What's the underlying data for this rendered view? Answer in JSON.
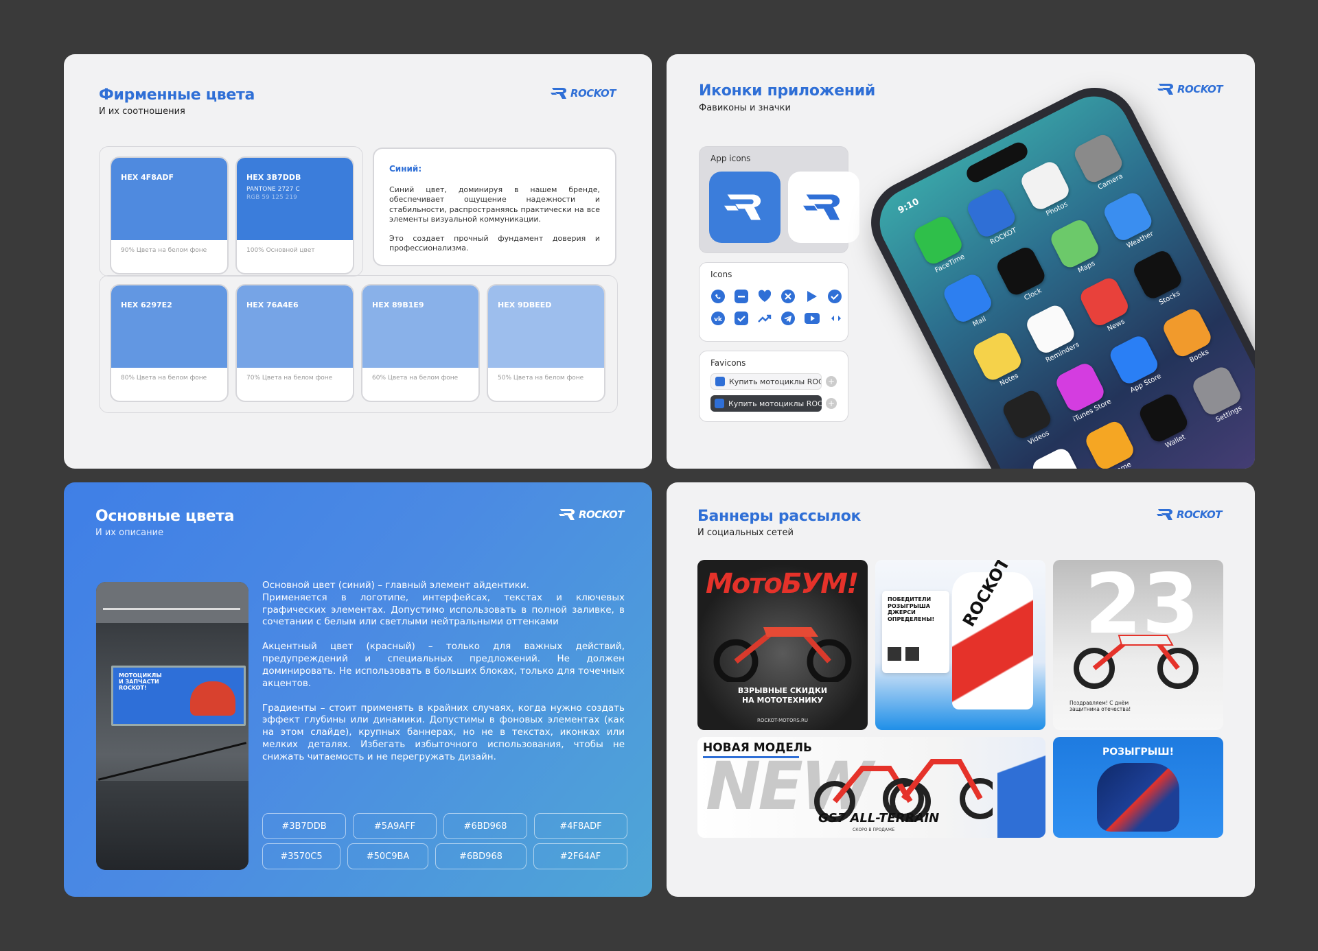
{
  "slide1": {
    "title": "Фирменные цвета",
    "subtitle": "И их соотношения",
    "logo_text": "ROCKOT",
    "cards": [
      {
        "hex": "HEX 4F8ADF",
        "color": "#4F8ADF",
        "extra1": "",
        "extra2": "",
        "caption": "90% Цвета на белом фоне"
      },
      {
        "hex": "HEX 3B7DDB",
        "color": "#3B7DDB",
        "extra1": "PANTONE 2727 C",
        "extra2": "RGB 59 125 219",
        "caption": "100% Основной цвет"
      },
      {
        "hex": "HEX 6297E2",
        "color": "#6297E2",
        "extra1": "",
        "extra2": "",
        "caption": "80% Цвета на белом фоне"
      },
      {
        "hex": "HEX 76A4E6",
        "color": "#76A4E6",
        "extra1": "",
        "extra2": "",
        "caption": "70% Цвета на белом фоне"
      },
      {
        "hex": "HEX 89B1E9",
        "color": "#89B1E9",
        "extra1": "",
        "extra2": "",
        "caption": "60% Цвета на белом фоне"
      },
      {
        "hex": "HEX 9DBEED",
        "color": "#9DBEED",
        "extra1": "",
        "extra2": "",
        "caption": "50% Цвета на белом фоне"
      }
    ],
    "desc_title": "Синий:",
    "desc_p1": "Синий цвет, доминируя в нашем бренде, обеспечивает ощущение надежности и стабильности, распространяясь практически на все элементы визуальной коммуникации.",
    "desc_p2": "Это создает прочный фундамент доверия и профессионализма."
  },
  "slide2": {
    "title": "Иконки приложений",
    "subtitle": "Фавиконы и значки",
    "logo_text": "ROCKOT",
    "app_icons_label": "App icons",
    "icons_label": "Icons",
    "icons": [
      "whatsapp-icon",
      "minus-icon",
      "heart-icon",
      "close-circle-icon",
      "play-icon",
      "check-circle-icon",
      "vk-icon",
      "checkbox-icon",
      "trend-up-icon",
      "telegram-icon",
      "youtube-icon",
      "arrows-icon"
    ],
    "favicons_label": "Favicons",
    "favicon_tab_text": "Купить мотоциклы ROCKOT",
    "phone": {
      "time": "9:10",
      "apps": [
        "FaceTime",
        "ROCKOT",
        "Photos",
        "Camera",
        "Mail",
        "Clock",
        "Maps",
        "Weather",
        "Notes",
        "Reminders",
        "News",
        "Stocks",
        "Videos",
        "iTunes Store",
        "App Store",
        "Books",
        "Health",
        "Home",
        "Wallet",
        "Settings"
      ]
    }
  },
  "slide3": {
    "title": "Основные цвета",
    "subtitle": "И их описание",
    "logo_text": "ROCKOT",
    "billboard_text": "МОТОЦИКЛЫ И ЗАПЧАСТИ ROCKOT!",
    "p1a": "Основной цвет (синий) – главный элемент айдентики.",
    "p1b": "Применяется в логотипе, интерфейсах, текстах и ключевых графических элементах. Допустимо использовать в полной заливке, в сочетании с белым или светлыми нейтральными оттенками",
    "p2": "Акцентный цвет (красный) – только для важных действий, предупреждений и специальных предложений. Не должен доминировать. Не использовать в больших блоках, только для точечных акцентов.",
    "p3": "Градиенты – стоит применять в крайних случаях, когда нужно создать эффект глубины или динамики. Допустимы в фоновых элементах (как на этом слайде), крупных баннерах, но не в текстах, иконках или мелких деталях. Избегать избыточного использования, чтобы не снижать читаемость и не перегружать дизайн.",
    "chips": [
      "#3B7DDB",
      "#5A9AFF",
      "#6BD968",
      "#4F8ADF",
      "#3570C5",
      "#50C9BA",
      "#6BD968",
      "#2F64AF"
    ]
  },
  "slide4": {
    "title": "Баннеры рассылок",
    "subtitle": "И социальных сетей",
    "logo_text": "ROCKOT",
    "b1_title": "МотоБУМ!",
    "b1_line1": "ВЗРЫВНЫЕ СКИДКИ",
    "b1_line2": "НА МОТОТЕХНИКУ",
    "b1_site": "ROCKOT-MOTORS.RU",
    "b2_title": "ПОБЕДИТЕЛИ РОЗЫГРЫША ДЖЕРСИ ОПРЕДЕЛЕНЫ!",
    "b2_jersey": "ROCKOT",
    "b3_number": "23",
    "b3_text": "Поздравляем! С днём защитника отечества!",
    "b4_label": "НОВАЯ МОДЕЛЬ",
    "b4_big": "NEW",
    "b4_model": "GS7 ALL-TERRAIN",
    "b4_soon": "СКОРО В ПРОДАЖЕ",
    "b5_title": "РОЗЫГРЫШ!"
  }
}
